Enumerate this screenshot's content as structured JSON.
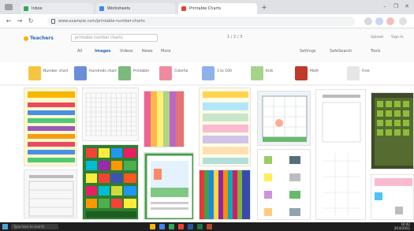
{
  "browser": {
    "tabs": [
      {
        "label": "Inbox",
        "active": false
      },
      {
        "label": "Worksheets",
        "active": false
      },
      {
        "label": "Printable Charts",
        "active": true
      }
    ],
    "new_tab": "+",
    "window_controls": [
      "–",
      "❐",
      "✕"
    ],
    "url": "www.example.com/printable-number-charts"
  },
  "site": {
    "logo": "Teachers",
    "search_placeholder": "printable number charts",
    "pager": "1 / 2 / 3",
    "header_links": [
      "Upload",
      "Sign In"
    ],
    "subnav": [
      "All",
      "Images",
      "Videos",
      "News",
      "More"
    ],
    "account": [
      "Settings",
      "SafeSearch",
      "Tools"
    ]
  },
  "chips": [
    {
      "label": "Number chart",
      "color": "#f5c542"
    },
    {
      "label": "Hundreds chart",
      "color": "#6a8fd6"
    },
    {
      "label": "Printable",
      "color": "#7db87d"
    },
    {
      "label": "Colorful",
      "color": "#f08aa0"
    },
    {
      "label": "1 to 100",
      "color": "#8fb0e8"
    },
    {
      "label": "Kids",
      "color": "#a6d38a"
    },
    {
      "label": "Math",
      "color": "#c0392b"
    },
    {
      "label": "Free",
      "color": "#e6e6e6"
    }
  ],
  "taskbar": {
    "search_placeholder": "Type here to search",
    "time": "10:42",
    "date": "3/14/2021"
  },
  "colors": {
    "tab_strip": "#dfe1e5",
    "accent_blue": "#2b6cb0",
    "taskbar": "#1e1e1e"
  }
}
